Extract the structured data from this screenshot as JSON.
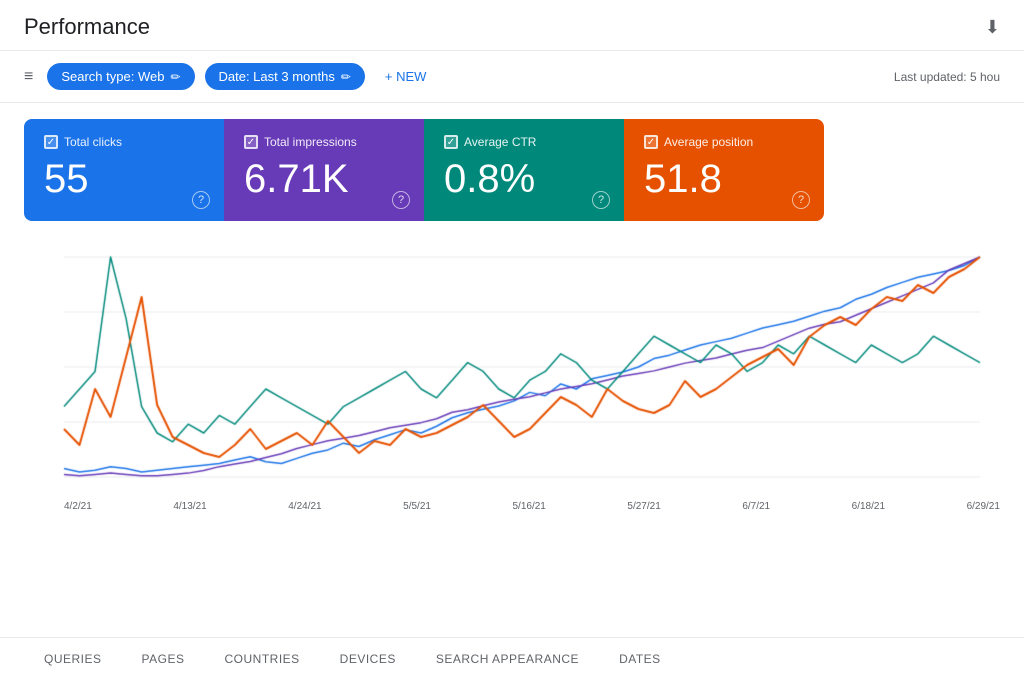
{
  "header": {
    "title": "Performance",
    "last_updated": "Last updated: 5 hou"
  },
  "filters": {
    "filter_icon_label": "≡",
    "chips": [
      {
        "label": "Search type: Web",
        "edit": "✏"
      },
      {
        "label": "Date: Last 3 months",
        "edit": "✏"
      }
    ],
    "new_button": "+ NEW"
  },
  "metrics": [
    {
      "id": "total-clicks",
      "label": "Total clicks",
      "value": "55",
      "color": "blue",
      "checked": true
    },
    {
      "id": "total-impressions",
      "label": "Total impressions",
      "value": "6.71K",
      "color": "purple",
      "checked": true
    },
    {
      "id": "average-ctr",
      "label": "Average CTR",
      "value": "0.8%",
      "color": "teal",
      "checked": true
    },
    {
      "id": "average-position",
      "label": "Average position",
      "value": "51.8",
      "color": "orange",
      "checked": true
    }
  ],
  "chart": {
    "x_labels": [
      "4/2/21",
      "4/13/21",
      "4/24/21",
      "5/5/21",
      "5/16/21",
      "5/27/21",
      "6/7/21",
      "6/18/21",
      "6/29/21"
    ],
    "series": {
      "clicks_color": "#e65100",
      "impressions_color": "#1a73e8",
      "ctr_color": "#00897b",
      "position_color": "#673ab7"
    }
  },
  "bottom_tabs": [
    {
      "label": "QUERIES",
      "active": false
    },
    {
      "label": "PAGES",
      "active": false
    },
    {
      "label": "COUNTRIES",
      "active": false
    },
    {
      "label": "DEVICES",
      "active": false
    },
    {
      "label": "SEARCH APPEARANCE",
      "active": false
    },
    {
      "label": "DATES",
      "active": false
    }
  ],
  "icons": {
    "download": "⬇",
    "filter": "≡",
    "edit": "✏",
    "plus": "+",
    "check": "✓",
    "question": "?"
  }
}
